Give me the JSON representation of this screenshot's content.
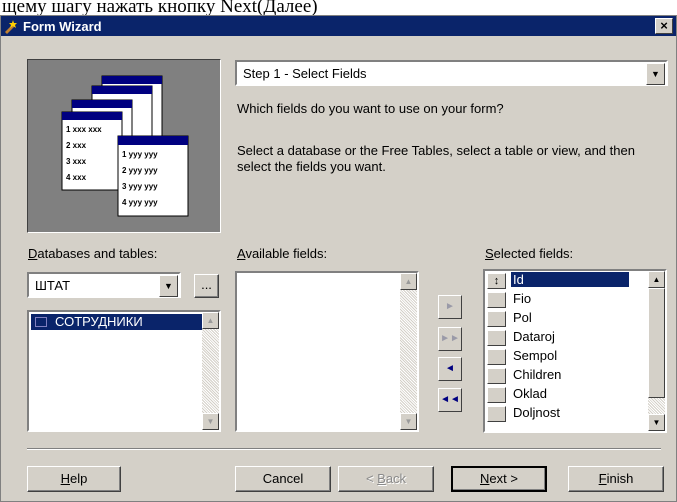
{
  "doc_caption": "щему шагу нажать кнопку Next(Далее)",
  "window": {
    "title": "Form Wizard",
    "close_glyph": "×"
  },
  "picture": {
    "left_table": [
      "1 xxx xxx",
      "2 xxx",
      "3 xxx",
      "4 xxx"
    ],
    "right_table": [
      "1 yyy yyy",
      "2 yyy yyy",
      "3 yyy yyy",
      "4 yyy yyy"
    ]
  },
  "step_combo": {
    "value": "Step 1 - Select Fields"
  },
  "question_text": "Which fields do you want to use on your form?",
  "instruction_text": "Select a database or the Free Tables, select a table or view, and then select the fields you want.",
  "databases": {
    "label_accel": "D",
    "label_rest": "atabases and tables:",
    "combo_value": "ШТАТ",
    "browse_label": "...",
    "tables": [
      "СОТРУДНИКИ"
    ]
  },
  "available": {
    "label_accel": "A",
    "label_rest": "vailable fields:",
    "items": []
  },
  "selected": {
    "label_accel": "S",
    "label_rest": "elected fields:",
    "items": [
      "Id",
      "Fio",
      "Pol",
      "Dataroj",
      "Sempol",
      "Children",
      "Oklad",
      "Doljnost"
    ],
    "selected_item": "Id"
  },
  "mover_buttons": {
    "add": "►",
    "add_all": "►►",
    "remove": "◄",
    "remove_all": "◄◄"
  },
  "buttons": {
    "help_accel": "H",
    "help_rest": "elp",
    "cancel": "Cancel",
    "back_prefix": "< ",
    "back_accel": "B",
    "back_rest": "ack",
    "next_accel": "N",
    "next_rest": "ext >",
    "finish_accel": "F",
    "finish_rest": "inish"
  },
  "colors": {
    "titlebar": "#0a246a",
    "dialog": "#d4d0c8",
    "selection": "#0a246a"
  }
}
